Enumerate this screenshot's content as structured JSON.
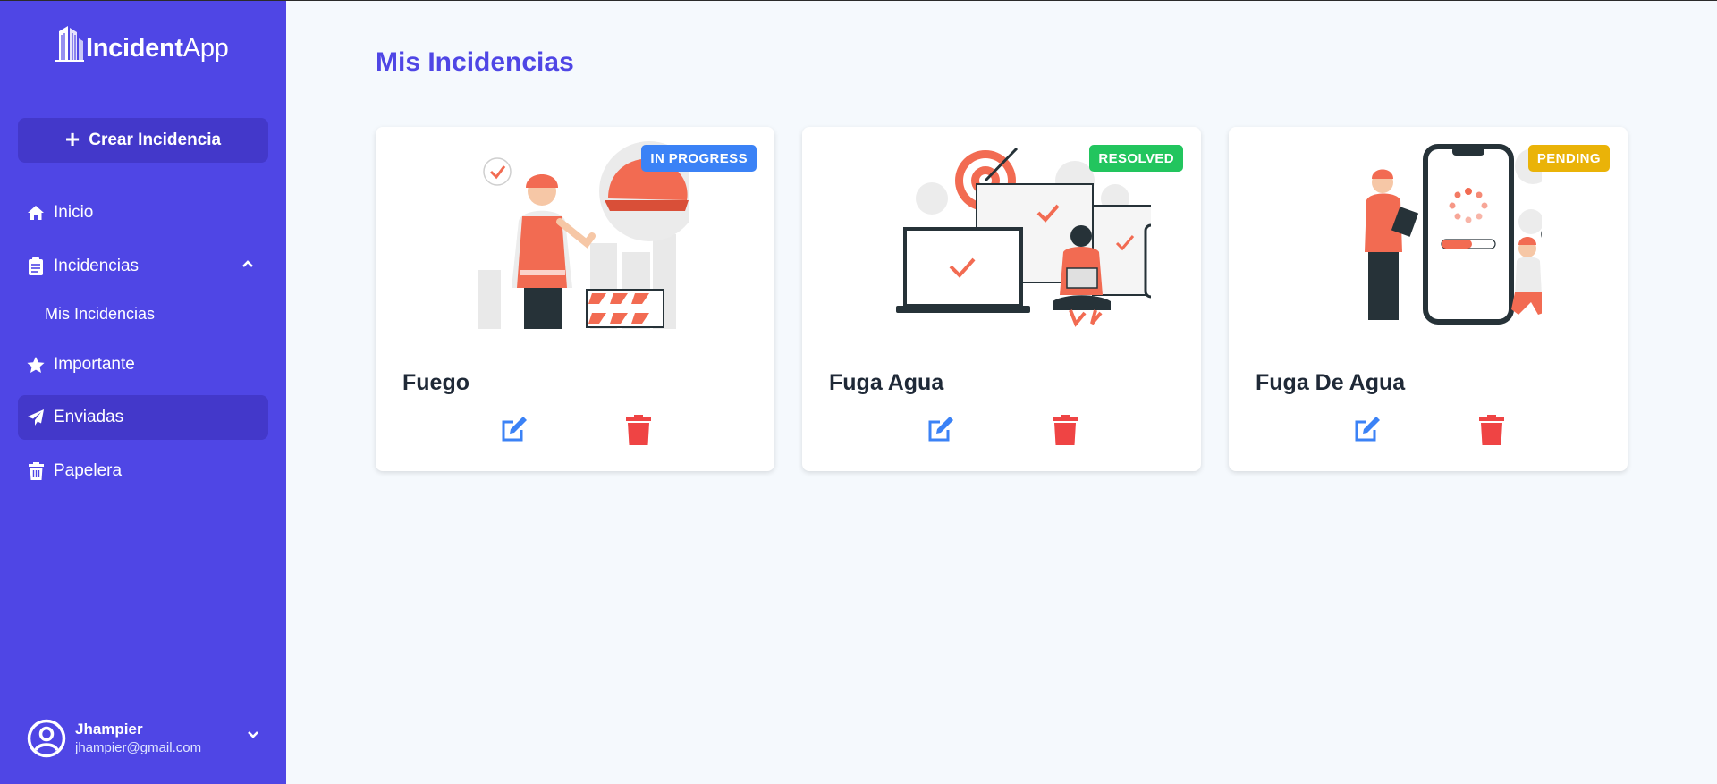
{
  "app": {
    "logo_bold": "Incident",
    "logo_light": "App"
  },
  "sidebar": {
    "create_label": "Crear Incidencia",
    "items": [
      {
        "label": "Inicio",
        "icon": "home-icon"
      },
      {
        "label": "Incidencias",
        "icon": "clipboard-icon"
      },
      {
        "label": "Mis Incidencias"
      },
      {
        "label": "Importante",
        "icon": "star-icon"
      },
      {
        "label": "Enviadas",
        "icon": "paper-plane-icon",
        "active": true
      },
      {
        "label": "Papelera",
        "icon": "trash-icon"
      }
    ],
    "user": {
      "name": "Jhampier",
      "email": "jhampier@gmail.com"
    }
  },
  "main": {
    "title": "Mis Incidencias",
    "cards": [
      {
        "title": "Fuego",
        "status": "IN PROGRESS",
        "status_color": "#3b82f6",
        "illustration": "construction-worker-illustration"
      },
      {
        "title": "Fuga Agua",
        "status": "RESOLVED",
        "status_color": "#22c55e",
        "illustration": "devices-target-illustration"
      },
      {
        "title": "Fuga De Agua",
        "status": "PENDING",
        "status_color": "#eab308",
        "illustration": "phone-checking-illustration"
      }
    ]
  },
  "colors": {
    "sidebar": "#4f46e5",
    "active": "#4338ca",
    "accent": "#f26b52",
    "edit": "#3b82f6",
    "delete": "#ef4444"
  }
}
